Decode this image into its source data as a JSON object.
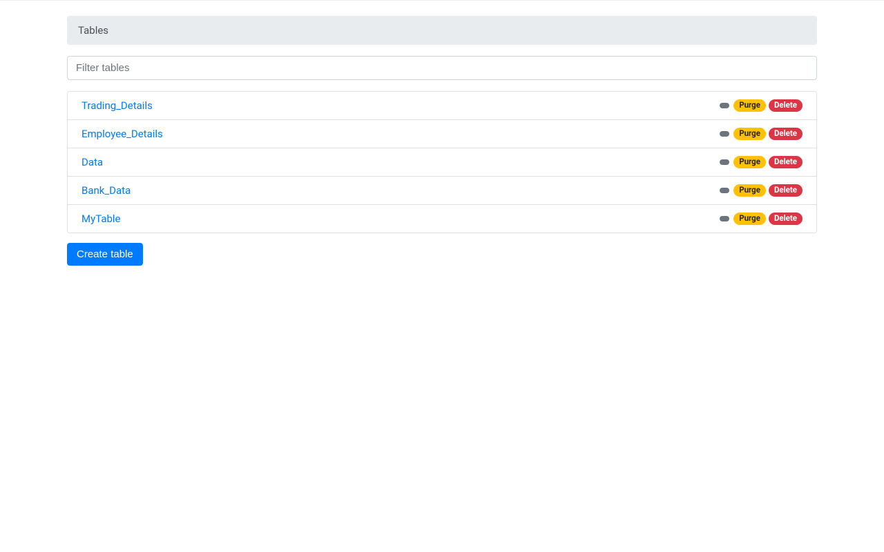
{
  "header": {
    "title": "Tables"
  },
  "filter": {
    "placeholder": "Filter tables",
    "value": ""
  },
  "actions": {
    "purge_label": "Purge",
    "delete_label": "Delete"
  },
  "tables": [
    {
      "name": "Trading_Details"
    },
    {
      "name": "Employee_Details"
    },
    {
      "name": "Data"
    },
    {
      "name": "Bank_Data"
    },
    {
      "name": "MyTable"
    }
  ],
  "create_button": {
    "label": "Create table"
  }
}
